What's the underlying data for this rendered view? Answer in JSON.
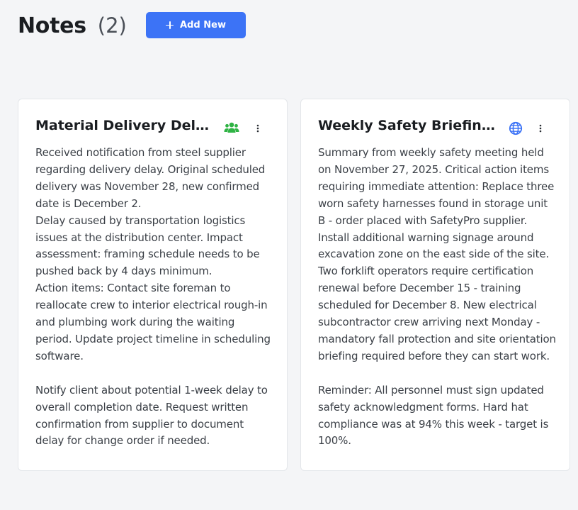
{
  "header": {
    "title": "Notes",
    "count": "(2)",
    "add_label": "Add New"
  },
  "colors": {
    "accent": "#3c73f6",
    "team_icon": "#2fb344",
    "globe_icon": "#3c73f6"
  },
  "notes": [
    {
      "title": "Material Delivery Delay - Steel Supplier",
      "visibility_icon": "team-icon",
      "body": "Received notification from steel supplier regarding delivery delay. Original scheduled delivery was November 28, new confirmed date is December 2.\nDelay caused by transportation logistics issues at the distribution center. Impact assessment: framing schedule needs to be pushed back by 4 days minimum.\nAction items: Contact site foreman to reallocate crew to interior electrical rough-in and plumbing work during the waiting period. Update project timeline in scheduling software.\n\nNotify client about potential 1-week delay to overall completion date. Request written confirmation from supplier to document delay for change order if needed."
    },
    {
      "title": "Weekly Safety Briefing Summary",
      "visibility_icon": "globe-icon",
      "body": "Summary from weekly safety meeting held on November 27, 2025. Critical action items requiring immediate attention: Replace three worn safety harnesses found in storage unit B - order placed with SafetyPro supplier.\nInstall additional warning signage around excavation zone on the east side of the site. Two forklift operators require certification renewal before December 15 - training scheduled for December 8. New electrical subcontractor crew arriving next Monday - mandatory fall protection and site orientation briefing required before they can start work.\n\nReminder: All personnel must sign updated safety acknowledgment forms. Hard hat compliance was at 94% this week - target is 100%."
    }
  ]
}
